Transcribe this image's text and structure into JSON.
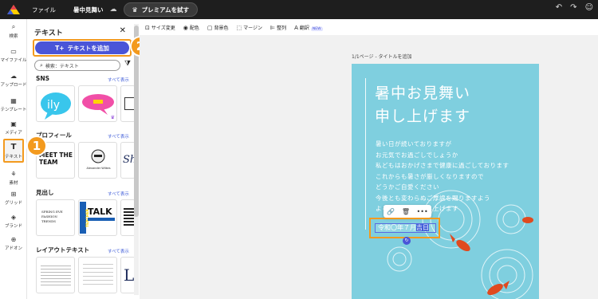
{
  "topbar": {
    "file_label": "ファイル",
    "doc_title": "暑中見舞い",
    "premium_label": "プレミアムを試す",
    "colors": {
      "bg": "#1e1e1e",
      "premium_bg": "#3a3a3a"
    }
  },
  "rail": {
    "items": [
      {
        "label": "検索",
        "icon": "search-icon"
      },
      {
        "label": "マイファイル",
        "icon": "folder-icon"
      },
      {
        "label": "アップロード",
        "icon": "upload-icon"
      },
      {
        "label": "テンプレート",
        "icon": "template-icon"
      },
      {
        "label": "メディア",
        "icon": "media-icon"
      },
      {
        "label": "テキスト",
        "icon": "text-icon"
      },
      {
        "label": "素材",
        "icon": "elements-icon"
      },
      {
        "label": "グリッド",
        "icon": "grid-icon"
      },
      {
        "label": "ブランド",
        "icon": "brand-icon"
      },
      {
        "label": "アドオン",
        "icon": "addon-icon"
      }
    ],
    "active_index": 5
  },
  "panel": {
    "title": "テキスト",
    "add_button": "テキストを追加",
    "search_placeholder": "検索：テキスト",
    "see_all": "すべて表示",
    "sections": [
      {
        "title": "SNS"
      },
      {
        "title": "プロフィール"
      },
      {
        "title": "見出し"
      },
      {
        "title": "レイアウトテキスト"
      }
    ],
    "thumbs": {
      "sns_1": "ily",
      "profile_1": "MEET THE TEAM",
      "profile_2": "Alexander Wilkes",
      "profile_3": "Sh",
      "heading_1": "SPRING EVE FASHION TRENDS",
      "heading_2": "TEACHER",
      "heading_3": "TALK",
      "layout_3": "L"
    }
  },
  "badges": {
    "one": "1",
    "two": "2"
  },
  "toolbar": {
    "items": [
      {
        "label": "サイズ変更",
        "icon": "resize-icon"
      },
      {
        "label": "配色",
        "icon": "palette-icon"
      },
      {
        "label": "背景色",
        "icon": "bg-color-icon"
      },
      {
        "label": "マージン",
        "icon": "margin-icon"
      },
      {
        "label": "整列",
        "icon": "align-icon"
      },
      {
        "label": "翻訳",
        "icon": "translate-icon"
      }
    ],
    "new_tag": "NEW"
  },
  "canvas": {
    "page_label": "1/1ページ - タイトルを追加",
    "heading_lines": [
      "暑中お見舞い",
      "申し上げます"
    ],
    "body_lines": [
      "暑い日が続いておりますが",
      "お元気でお過ごしでしょうか",
      "私どもはおかげさまで健康に過ごしております",
      "これからも暑さが厳しくなりますので",
      "どうかご自愛ください",
      "今後とも変わらぬご厚誼を賜りますよう",
      "よろしくお願い申し上げます"
    ],
    "date_prefix": "令和〇年７月",
    "date_highlight": "吉日",
    "colors": {
      "card_bg": "#7fcfdf",
      "accent": "#f39a1e",
      "primary": "#4a55d8"
    }
  }
}
